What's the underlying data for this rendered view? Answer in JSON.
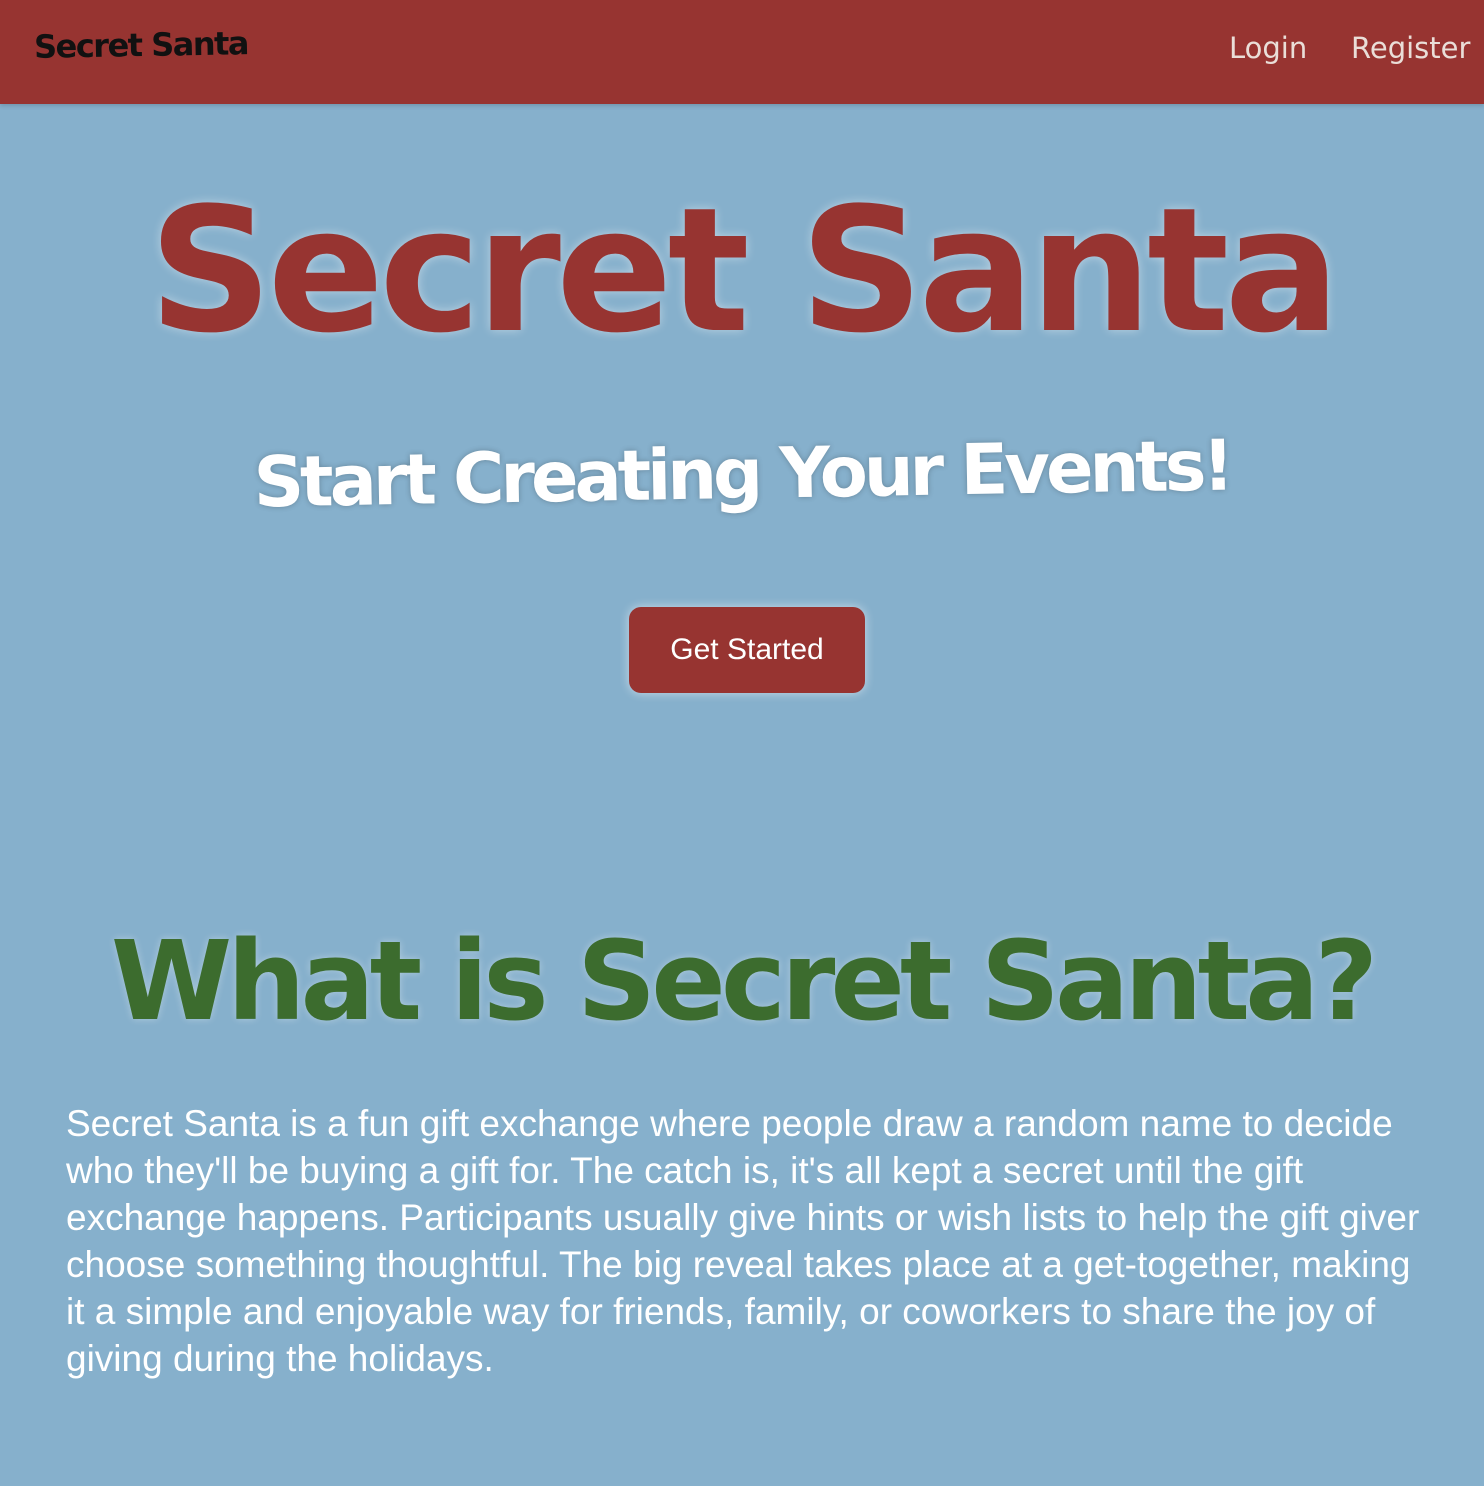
{
  "navbar": {
    "brand": "Secret Santa",
    "login_label": "Login",
    "register_label": "Register"
  },
  "hero": {
    "title": "Secret Santa",
    "subtitle": "Start Creating Your Events!",
    "cta_label": "Get Started"
  },
  "about": {
    "heading": "What is Secret Santa?",
    "body": "Secret Santa is a fun gift exchange where people draw a random name to decide who they'll be buying a gift for. The catch is, it's all kept a secret until the gift exchange happens. Participants usually give hints or wish lists to help the gift giver choose something thoughtful. The big reveal takes place at a get-together, making it a simple and enjoyable way for friends, family, or coworkers to share the joy of giving during the holidays."
  },
  "colors": {
    "navbar_bg": "#973431",
    "page_bg": "#86b0cc",
    "title_red": "#973431",
    "heading_green": "#3c6c2e",
    "button_bg": "#973431",
    "text_white": "#ffffff"
  }
}
